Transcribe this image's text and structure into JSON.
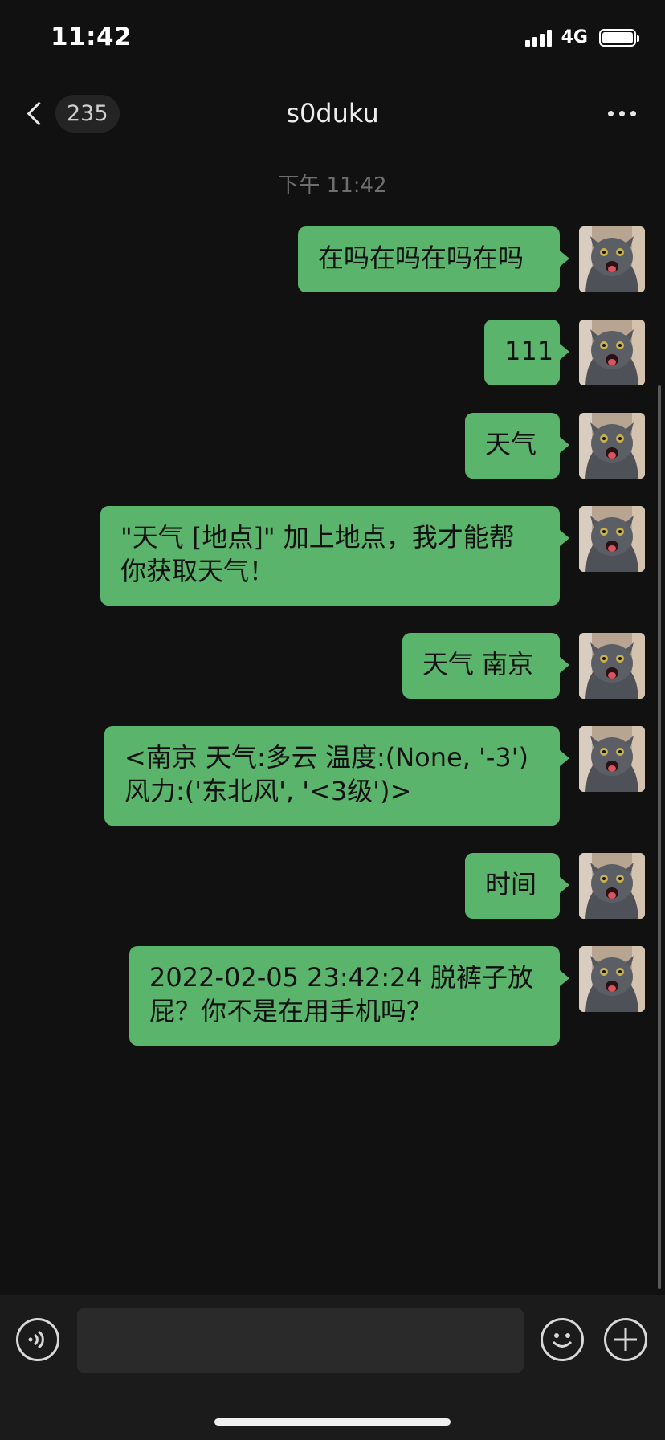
{
  "status_bar": {
    "time": "11:42",
    "network": "4G"
  },
  "nav": {
    "unread_count": "235",
    "title": "s0duku"
  },
  "chat": {
    "timestamp": "下午 11:42",
    "messages": [
      {
        "text": "在吗在吗在吗在吗"
      },
      {
        "text": "111"
      },
      {
        "text": "天气"
      },
      {
        "lines": [
          "\"天气 [地点]\" 加上地点，我才能帮",
          "你获取天气！"
        ]
      },
      {
        "text": "天气 南京"
      },
      {
        "lines": [
          "<南京 天气:多云 温度:(None, '-3')",
          "风力:('东北风', '<3级')>"
        ]
      },
      {
        "text": "时间"
      },
      {
        "lines": [
          "2022-02-05 23:42:24 脱裤子放",
          "屁？你不是在用手机吗？"
        ]
      }
    ]
  },
  "input_bar": {
    "placeholder": ""
  },
  "colors": {
    "bubble": "#5ab46c",
    "background": "#111111",
    "input_bar": "#1b1b1b"
  },
  "icons": [
    "back-chevron-icon",
    "more-dots-icon",
    "voice-icon",
    "emoji-icon",
    "plus-icon",
    "cat-avatar"
  ]
}
